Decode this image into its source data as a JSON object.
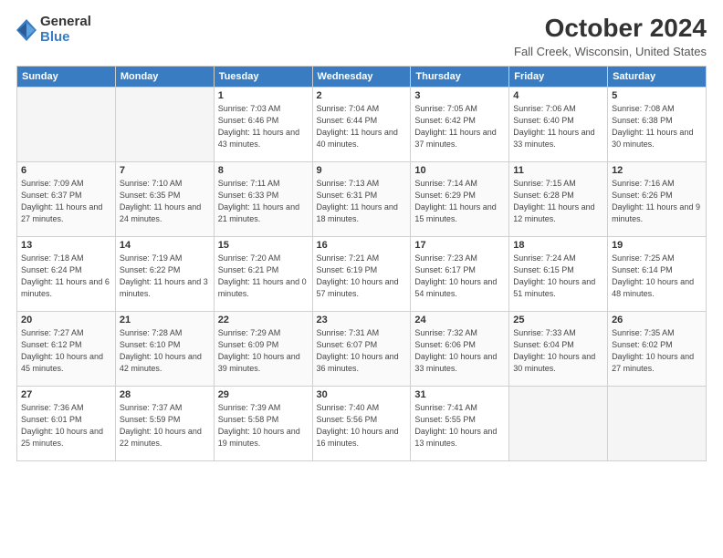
{
  "logo": {
    "general": "General",
    "blue": "Blue"
  },
  "header": {
    "month": "October 2024",
    "location": "Fall Creek, Wisconsin, United States"
  },
  "days_of_week": [
    "Sunday",
    "Monday",
    "Tuesday",
    "Wednesday",
    "Thursday",
    "Friday",
    "Saturday"
  ],
  "weeks": [
    [
      {
        "day": "",
        "empty": true
      },
      {
        "day": "",
        "empty": true
      },
      {
        "day": "1",
        "sunrise": "Sunrise: 7:03 AM",
        "sunset": "Sunset: 6:46 PM",
        "daylight": "Daylight: 11 hours and 43 minutes."
      },
      {
        "day": "2",
        "sunrise": "Sunrise: 7:04 AM",
        "sunset": "Sunset: 6:44 PM",
        "daylight": "Daylight: 11 hours and 40 minutes."
      },
      {
        "day": "3",
        "sunrise": "Sunrise: 7:05 AM",
        "sunset": "Sunset: 6:42 PM",
        "daylight": "Daylight: 11 hours and 37 minutes."
      },
      {
        "day": "4",
        "sunrise": "Sunrise: 7:06 AM",
        "sunset": "Sunset: 6:40 PM",
        "daylight": "Daylight: 11 hours and 33 minutes."
      },
      {
        "day": "5",
        "sunrise": "Sunrise: 7:08 AM",
        "sunset": "Sunset: 6:38 PM",
        "daylight": "Daylight: 11 hours and 30 minutes."
      }
    ],
    [
      {
        "day": "6",
        "sunrise": "Sunrise: 7:09 AM",
        "sunset": "Sunset: 6:37 PM",
        "daylight": "Daylight: 11 hours and 27 minutes."
      },
      {
        "day": "7",
        "sunrise": "Sunrise: 7:10 AM",
        "sunset": "Sunset: 6:35 PM",
        "daylight": "Daylight: 11 hours and 24 minutes."
      },
      {
        "day": "8",
        "sunrise": "Sunrise: 7:11 AM",
        "sunset": "Sunset: 6:33 PM",
        "daylight": "Daylight: 11 hours and 21 minutes."
      },
      {
        "day": "9",
        "sunrise": "Sunrise: 7:13 AM",
        "sunset": "Sunset: 6:31 PM",
        "daylight": "Daylight: 11 hours and 18 minutes."
      },
      {
        "day": "10",
        "sunrise": "Sunrise: 7:14 AM",
        "sunset": "Sunset: 6:29 PM",
        "daylight": "Daylight: 11 hours and 15 minutes."
      },
      {
        "day": "11",
        "sunrise": "Sunrise: 7:15 AM",
        "sunset": "Sunset: 6:28 PM",
        "daylight": "Daylight: 11 hours and 12 minutes."
      },
      {
        "day": "12",
        "sunrise": "Sunrise: 7:16 AM",
        "sunset": "Sunset: 6:26 PM",
        "daylight": "Daylight: 11 hours and 9 minutes."
      }
    ],
    [
      {
        "day": "13",
        "sunrise": "Sunrise: 7:18 AM",
        "sunset": "Sunset: 6:24 PM",
        "daylight": "Daylight: 11 hours and 6 minutes."
      },
      {
        "day": "14",
        "sunrise": "Sunrise: 7:19 AM",
        "sunset": "Sunset: 6:22 PM",
        "daylight": "Daylight: 11 hours and 3 minutes."
      },
      {
        "day": "15",
        "sunrise": "Sunrise: 7:20 AM",
        "sunset": "Sunset: 6:21 PM",
        "daylight": "Daylight: 11 hours and 0 minutes."
      },
      {
        "day": "16",
        "sunrise": "Sunrise: 7:21 AM",
        "sunset": "Sunset: 6:19 PM",
        "daylight": "Daylight: 10 hours and 57 minutes."
      },
      {
        "day": "17",
        "sunrise": "Sunrise: 7:23 AM",
        "sunset": "Sunset: 6:17 PM",
        "daylight": "Daylight: 10 hours and 54 minutes."
      },
      {
        "day": "18",
        "sunrise": "Sunrise: 7:24 AM",
        "sunset": "Sunset: 6:15 PM",
        "daylight": "Daylight: 10 hours and 51 minutes."
      },
      {
        "day": "19",
        "sunrise": "Sunrise: 7:25 AM",
        "sunset": "Sunset: 6:14 PM",
        "daylight": "Daylight: 10 hours and 48 minutes."
      }
    ],
    [
      {
        "day": "20",
        "sunrise": "Sunrise: 7:27 AM",
        "sunset": "Sunset: 6:12 PM",
        "daylight": "Daylight: 10 hours and 45 minutes."
      },
      {
        "day": "21",
        "sunrise": "Sunrise: 7:28 AM",
        "sunset": "Sunset: 6:10 PM",
        "daylight": "Daylight: 10 hours and 42 minutes."
      },
      {
        "day": "22",
        "sunrise": "Sunrise: 7:29 AM",
        "sunset": "Sunset: 6:09 PM",
        "daylight": "Daylight: 10 hours and 39 minutes."
      },
      {
        "day": "23",
        "sunrise": "Sunrise: 7:31 AM",
        "sunset": "Sunset: 6:07 PM",
        "daylight": "Daylight: 10 hours and 36 minutes."
      },
      {
        "day": "24",
        "sunrise": "Sunrise: 7:32 AM",
        "sunset": "Sunset: 6:06 PM",
        "daylight": "Daylight: 10 hours and 33 minutes."
      },
      {
        "day": "25",
        "sunrise": "Sunrise: 7:33 AM",
        "sunset": "Sunset: 6:04 PM",
        "daylight": "Daylight: 10 hours and 30 minutes."
      },
      {
        "day": "26",
        "sunrise": "Sunrise: 7:35 AM",
        "sunset": "Sunset: 6:02 PM",
        "daylight": "Daylight: 10 hours and 27 minutes."
      }
    ],
    [
      {
        "day": "27",
        "sunrise": "Sunrise: 7:36 AM",
        "sunset": "Sunset: 6:01 PM",
        "daylight": "Daylight: 10 hours and 25 minutes."
      },
      {
        "day": "28",
        "sunrise": "Sunrise: 7:37 AM",
        "sunset": "Sunset: 5:59 PM",
        "daylight": "Daylight: 10 hours and 22 minutes."
      },
      {
        "day": "29",
        "sunrise": "Sunrise: 7:39 AM",
        "sunset": "Sunset: 5:58 PM",
        "daylight": "Daylight: 10 hours and 19 minutes."
      },
      {
        "day": "30",
        "sunrise": "Sunrise: 7:40 AM",
        "sunset": "Sunset: 5:56 PM",
        "daylight": "Daylight: 10 hours and 16 minutes."
      },
      {
        "day": "31",
        "sunrise": "Sunrise: 7:41 AM",
        "sunset": "Sunset: 5:55 PM",
        "daylight": "Daylight: 10 hours and 13 minutes."
      },
      {
        "day": "",
        "empty": true
      },
      {
        "day": "",
        "empty": true
      }
    ]
  ]
}
